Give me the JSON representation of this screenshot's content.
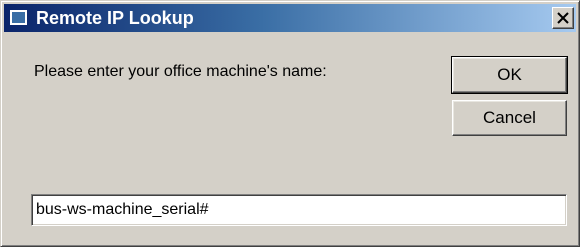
{
  "window": {
    "title": "Remote IP Lookup",
    "close_label": "close"
  },
  "dialog": {
    "prompt": "Please enter your office machine's name:",
    "ok_label": "OK",
    "cancel_label": "Cancel",
    "machine_name_value": "bus-ws-machine_serial#"
  },
  "icons": {
    "app": "application-icon",
    "close": "close-icon"
  },
  "colors": {
    "titlebar_start": "#0a246a",
    "titlebar_end": "#a6caf0",
    "dialog_face": "#d4d0c8"
  }
}
